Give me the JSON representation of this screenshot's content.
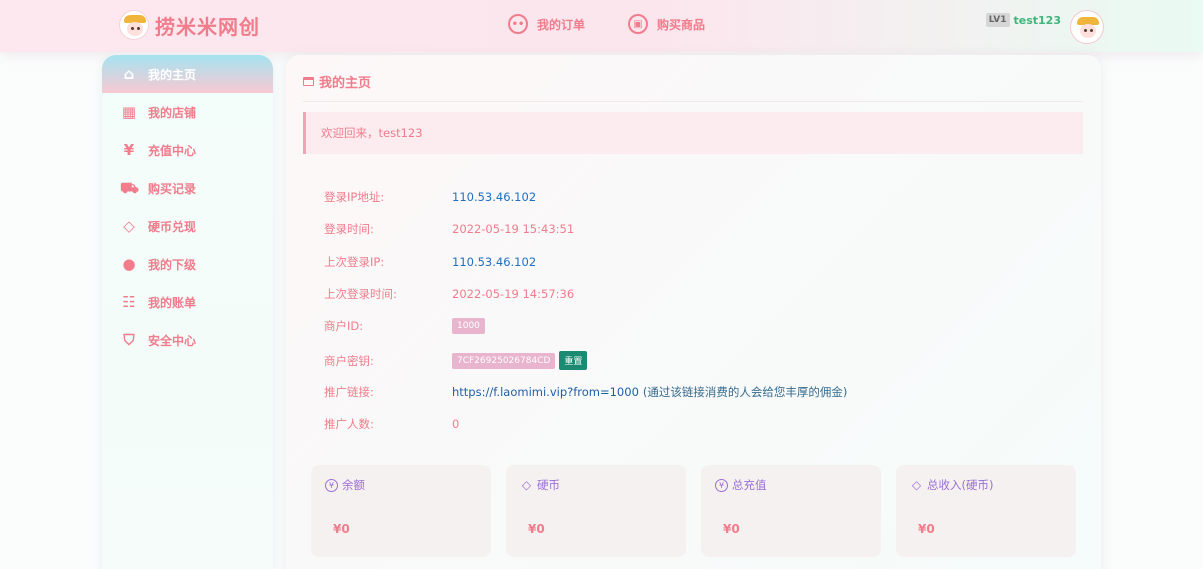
{
  "header": {
    "brand": "捞米米网创",
    "nav": [
      {
        "label": "我的订单",
        "icon": "chat-bubble-icon"
      },
      {
        "label": "购买商品",
        "icon": "shop-icon"
      }
    ],
    "level_badge": "LV1",
    "username": "test123"
  },
  "sidebar": {
    "items": [
      {
        "label": "我的主页",
        "icon": "home-icon",
        "active": true
      },
      {
        "label": "我的店铺",
        "icon": "grid-icon"
      },
      {
        "label": "充值中心",
        "icon": "yen-icon"
      },
      {
        "label": "购买记录",
        "icon": "cart-icon"
      },
      {
        "label": "硬币兑现",
        "icon": "diamond-icon"
      },
      {
        "label": "我的下级",
        "icon": "user-icon"
      },
      {
        "label": "我的账单",
        "icon": "clipboard-icon"
      },
      {
        "label": "安全中心",
        "icon": "shield-icon"
      }
    ]
  },
  "main": {
    "title": "我的主页",
    "welcome": "欢迎回来，test123",
    "info": {
      "login_ip_label": "登录IP地址:",
      "login_ip": "110.53.46.102",
      "login_time_label": "登录时间:",
      "login_time": "2022-05-19 15:43:51",
      "last_ip_label": "上次登录IP:",
      "last_ip": "110.53.46.102",
      "last_time_label": "上次登录时间:",
      "last_time": "2022-05-19 14:57:36",
      "merchant_id_label": "商户ID:",
      "merchant_id": "1000",
      "merchant_key_label": "商户密钥:",
      "merchant_key": "7CF26925026784CD",
      "reset_label": "重置",
      "promo_label": "推广链接:",
      "promo_link": "https://f.laomimi.vip?from=1000",
      "promo_note": "(通过该链接消费的人会给您丰厚的佣金)",
      "referrals_label": "推广人数:",
      "referrals": "0"
    },
    "cards": [
      {
        "title": "余额",
        "icon": "yen-icon",
        "value": "¥0"
      },
      {
        "title": "硬币",
        "icon": "diamond-icon",
        "value": "¥0"
      },
      {
        "title": "总充值",
        "icon": "yen-icon",
        "value": "¥0"
      },
      {
        "title": "总收入(硬币)",
        "icon": "diamond-icon",
        "value": "¥0"
      }
    ]
  },
  "colors": {
    "accent_pink": "#f07c8c",
    "info_blue": "#1e6fc2",
    "card_purple": "#9a6fd4",
    "reset_green": "#1b8a72"
  }
}
